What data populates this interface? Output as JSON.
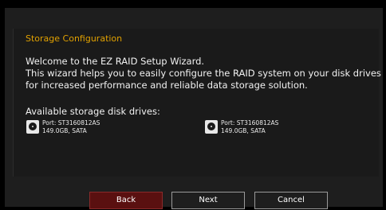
{
  "panel": {
    "title": "Storage Configuration",
    "intro_lines": [
      "Welcome to the EZ RAID Setup Wizard.",
      "This wizard helps you to easily configure the RAID system on your disk drives",
      "for increased performance and reliable data storage solution."
    ],
    "available_label": "Available storage disk drives:"
  },
  "drives": [
    {
      "port": "Port: ST3160812AS",
      "capacity": "149.0GB, SATA",
      "icon": "hard-disk-icon"
    },
    {
      "port": "Port: ST3160812AS",
      "capacity": "149.0GB, SATA",
      "icon": "hard-disk-icon"
    }
  ],
  "buttons": {
    "back": "Back",
    "next": "Next",
    "cancel": "Cancel"
  },
  "colors": {
    "title": "#e0a000",
    "back_active": "#5a1010"
  }
}
